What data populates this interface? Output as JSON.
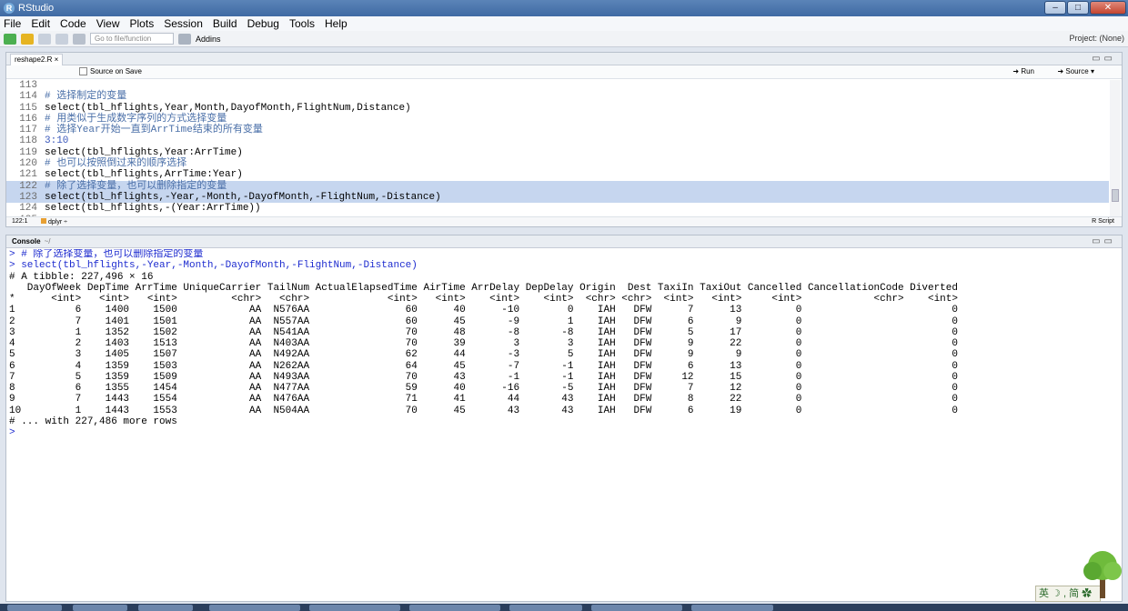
{
  "app": {
    "title": "RStudio",
    "icon_letter": "R"
  },
  "window_controls": [
    "minimize-icon",
    "maximize-icon",
    "close-icon"
  ],
  "menu": [
    "File",
    "Edit",
    "Code",
    "View",
    "Plots",
    "Session",
    "Build",
    "Debug",
    "Tools",
    "Help"
  ],
  "toolbar": {
    "goto_placeholder": "Go to file/function",
    "addins": "Addins",
    "project": "Project: (None)"
  },
  "source": {
    "tab_label": "reshape2.R",
    "source_on_save": "Source on Save",
    "run_label": "Run",
    "source_label": "Source",
    "lines": [
      {
        "num": "113",
        "text": "",
        "type": "normal",
        "hl": false
      },
      {
        "num": "114",
        "text": "# 选择制定的变量",
        "type": "comment",
        "hl": false
      },
      {
        "num": "115",
        "text": "select(tbl_hflights,Year,Month,DayofMonth,FlightNum,Distance)",
        "type": "normal",
        "hl": false
      },
      {
        "num": "116",
        "text": "# 用类似于生成数字序列的方式选择变量",
        "type": "comment",
        "hl": false
      },
      {
        "num": "117",
        "text": "# 选择Year开始一直到ArrTime结束的所有变量",
        "type": "comment",
        "hl": false
      },
      {
        "num": "118",
        "text": "3:10",
        "type": "number",
        "hl": false
      },
      {
        "num": "119",
        "text": "select(tbl_hflights,Year:ArrTime)",
        "type": "normal",
        "hl": false
      },
      {
        "num": "120",
        "text": "# 也可以按照倒过来的顺序选择",
        "type": "comment",
        "hl": false
      },
      {
        "num": "121",
        "text": "select(tbl_hflights,ArrTime:Year)",
        "type": "normal",
        "hl": false
      },
      {
        "num": "122",
        "text": "# 除了选择变量，也可以删除指定的变量",
        "type": "comment",
        "hl": true
      },
      {
        "num": "123",
        "text": "select(tbl_hflights,-Year,-Month,-DayofMonth,-FlightNum,-Distance)",
        "type": "normal",
        "hl": true
      },
      {
        "num": "124",
        "text": "select(tbl_hflights,-(Year:ArrTime))",
        "type": "normal",
        "hl": false
      },
      {
        "num": "125",
        "text": "",
        "type": "normal",
        "hl": false
      }
    ],
    "status_pos": "122:1",
    "status_scope": "dplyr",
    "status_filetype": "R Script"
  },
  "console": {
    "title": "Console",
    "dir": "~/",
    "lines": [
      {
        "text": "> # 除了选择变量，也可以删除指定的变量",
        "type": "cmd"
      },
      {
        "text": "> select(tbl_hflights,-Year,-Month,-DayofMonth,-FlightNum,-Distance)",
        "type": "cmd"
      },
      {
        "text": "# A tibble: 227,496 × 16",
        "type": "out"
      },
      {
        "text": "   DayOfWeek DepTime ArrTime UniqueCarrier TailNum ActualElapsedTime AirTime ArrDelay DepDelay Origin  Dest TaxiIn TaxiOut Cancelled CancellationCode Diverted",
        "type": "out"
      },
      {
        "text": "*      <int>   <int>   <int>         <chr>   <chr>             <int>   <int>    <int>    <int>  <chr> <chr>  <int>   <int>     <int>            <chr>    <int>",
        "type": "out"
      },
      {
        "text": "1          6    1400    1500            AA  N576AA                60      40      -10        0    IAH   DFW      7      13         0                         0",
        "type": "out"
      },
      {
        "text": "2          7    1401    1501            AA  N557AA                60      45       -9        1    IAH   DFW      6       9         0                         0",
        "type": "out"
      },
      {
        "text": "3          1    1352    1502            AA  N541AA                70      48       -8       -8    IAH   DFW      5      17         0                         0",
        "type": "out"
      },
      {
        "text": "4          2    1403    1513            AA  N403AA                70      39        3        3    IAH   DFW      9      22         0                         0",
        "type": "out"
      },
      {
        "text": "5          3    1405    1507            AA  N492AA                62      44       -3        5    IAH   DFW      9       9         0                         0",
        "type": "out"
      },
      {
        "text": "6          4    1359    1503            AA  N262AA                64      45       -7       -1    IAH   DFW      6      13         0                         0",
        "type": "out"
      },
      {
        "text": "7          5    1359    1509            AA  N493AA                70      43       -1       -1    IAH   DFW     12      15         0                         0",
        "type": "out"
      },
      {
        "text": "8          6    1355    1454            AA  N477AA                59      40      -16       -5    IAH   DFW      7      12         0                         0",
        "type": "out"
      },
      {
        "text": "9          7    1443    1554            AA  N476AA                71      41       44       43    IAH   DFW      8      22         0                         0",
        "type": "out"
      },
      {
        "text": "10         1    1443    1553            AA  N504AA                70      45       43       43    IAH   DFW      6      19         0                         0",
        "type": "out"
      },
      {
        "text": "# ... with 227,486 more rows",
        "type": "out"
      },
      {
        "text": ">",
        "type": "cmd"
      }
    ]
  },
  "ime": {
    "label": "英 ☽ , 简 ✿"
  },
  "colors": {
    "titlebar": "#4a76ad",
    "comment": "#4a6fa8",
    "command": "#1d2bcf",
    "highlight": "#c6d6ef"
  }
}
